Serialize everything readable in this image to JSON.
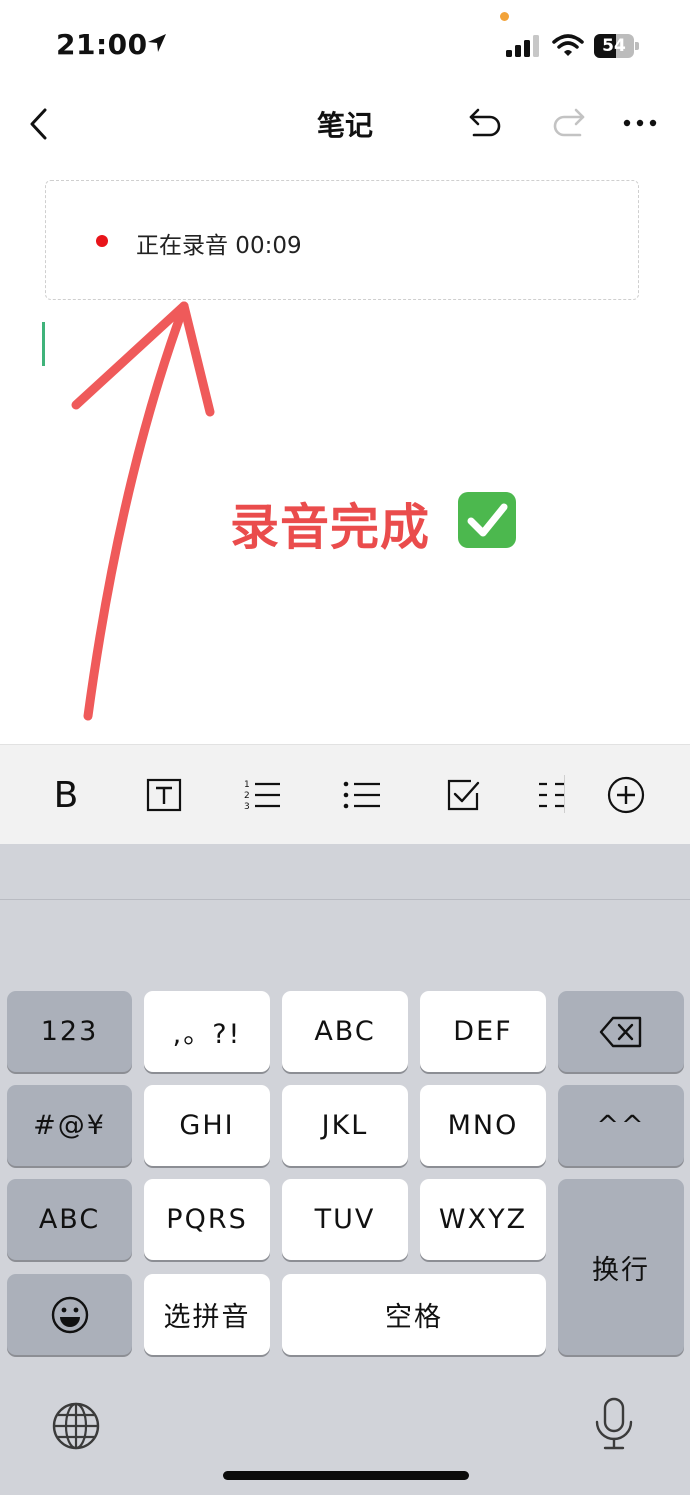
{
  "status_bar": {
    "time": "21:00",
    "battery": "54",
    "battery_level": 0.54
  },
  "header": {
    "title": "笔记"
  },
  "recording": {
    "text": "正在录音 00:09"
  },
  "annotation": {
    "text": "录音完成"
  },
  "toolbar": {
    "bold_label": "B"
  },
  "keyboard": {
    "row1": {
      "left": "123",
      "k1": ",。?!",
      "k2": "ABC",
      "k3": "DEF"
    },
    "row2": {
      "left": "#@¥",
      "k1": "GHI",
      "k2": "JKL",
      "k3": "MNO",
      "right": "^^"
    },
    "row3": {
      "left": "ABC",
      "k1": "PQRS",
      "k2": "TUV",
      "k3": "WXYZ",
      "right": "换行"
    },
    "row4": {
      "pinyin": "选拼音",
      "space": "空格"
    }
  },
  "colors": {
    "accent_red": "#ea4c4c",
    "recording_dot": "#e8141a",
    "caret": "#3fb37a",
    "keyboard_bg": "#d1d3d9"
  },
  "icons": [
    "navigation-arrow-icon",
    "signal-icon",
    "wifi-icon",
    "battery-icon",
    "back-chevron-icon",
    "undo-icon",
    "redo-icon",
    "more-icon",
    "text-box-icon",
    "numbered-list-icon",
    "bullet-list-icon",
    "checkbox-icon",
    "indent-icon",
    "add-circle-icon",
    "backspace-icon",
    "emoji-icon",
    "globe-icon",
    "microphone-icon",
    "check-mark-icon"
  ]
}
